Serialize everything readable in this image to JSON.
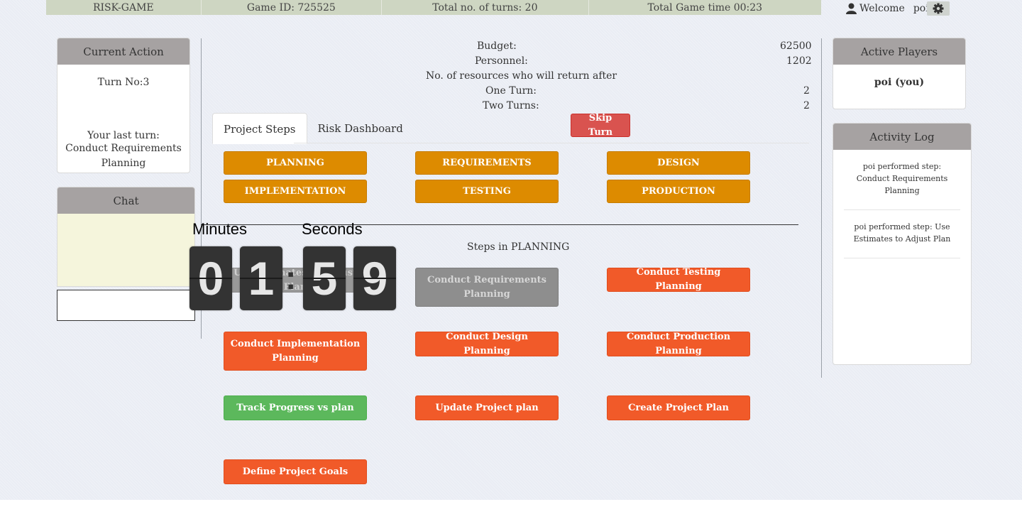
{
  "topbar": {
    "game_name": "RISK-GAME",
    "game_id": "Game ID: 725525",
    "total_turns": "Total no. of turns: 20",
    "total_time": "Total Game time 00:23"
  },
  "user": {
    "welcome": "Welcome",
    "name": "poi!"
  },
  "current_action": {
    "title": "Current Action",
    "turn": "Turn No:3",
    "last_turn_label": "Your last turn:",
    "last_turn_value": "Conduct Requirements Planning"
  },
  "chat": {
    "title": "Chat",
    "input_value": ""
  },
  "stats": {
    "budget_label": "Budget:",
    "budget_value": "62500",
    "personnel_label": "Personnel:",
    "personnel_value": "1202",
    "resources_label": "No. of resources who will return after",
    "one_turn_label": "One Turn:",
    "one_turn_value": "2",
    "two_turns_label": "Two Turns:",
    "two_turns_value": "2"
  },
  "tabs": [
    "Project Steps",
    "Risk Dashboard"
  ],
  "skip_turn": "Skip Turn",
  "phases": [
    "PLANNING",
    "REQUIREMENTS",
    "DESIGN",
    "IMPLEMENTATION",
    "TESTING",
    "PRODUCTION"
  ],
  "steps_title": "Steps in PLANNING",
  "steps": {
    "use_estimates": "Use Estimates to Adjust Plan",
    "conduct_requirements": "Conduct Requirements Planning",
    "conduct_testing": "Conduct Testing Planning",
    "conduct_implementation": "Conduct Implementation Planning",
    "conduct_design": "Conduct Design Planning",
    "conduct_production": "Conduct Production Planning",
    "track_progress": "Track Progress vs plan",
    "update_plan": "Update Project plan",
    "create_plan": "Create Project Plan",
    "define_goals": "Define Project Goals"
  },
  "timer": {
    "minutes_label": "Minutes",
    "seconds_label": "Seconds",
    "digits": [
      "0",
      "1",
      "5",
      "9"
    ],
    "separator": ":"
  },
  "active_players": {
    "title": "Active Players",
    "players": [
      "poi (you)"
    ]
  },
  "activity_log": {
    "title": "Activity Log",
    "entries": [
      "poi performed step: Conduct Requirements Planning",
      "poi performed step: Use Estimates to Adjust Plan"
    ]
  },
  "colors": {
    "phase": "#dd8b00",
    "step": "#f15a29",
    "done": "#8e8e8e",
    "green": "#5cb85c",
    "skip": "#d9534f",
    "panel_header": "#a6a2a2"
  }
}
